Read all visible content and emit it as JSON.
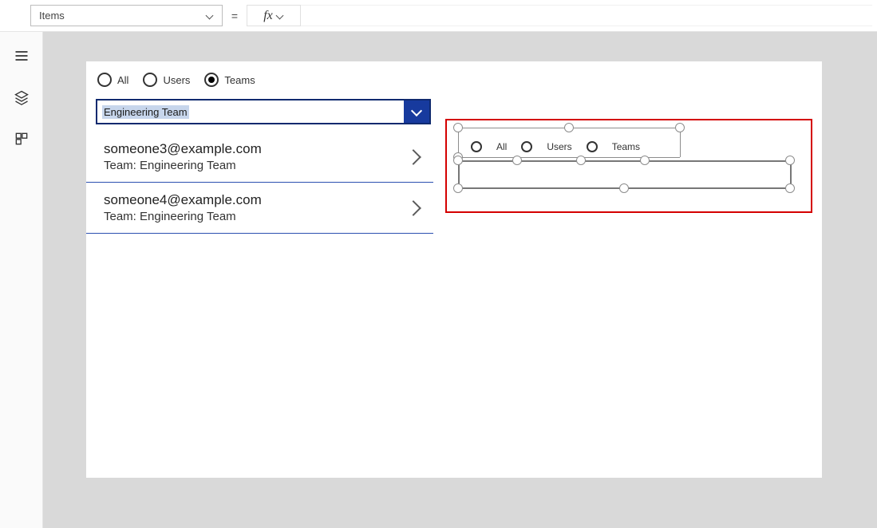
{
  "formula_bar": {
    "property": "Items",
    "equals": "=",
    "fx_label": "fx"
  },
  "left_rail": {
    "icons": [
      "menu",
      "layers",
      "components"
    ]
  },
  "app": {
    "filter": {
      "options": [
        "All",
        "Users",
        "Teams"
      ],
      "selected_index": 2
    },
    "combo": {
      "value": "Engineering Team"
    },
    "list": [
      {
        "title": "someone3@example.com",
        "subtitle": "Team: Engineering Team"
      },
      {
        "title": "someone4@example.com",
        "subtitle": "Team: Engineering Team"
      }
    ]
  },
  "design": {
    "filter_options": [
      "All",
      "Users",
      "Teams"
    ]
  }
}
